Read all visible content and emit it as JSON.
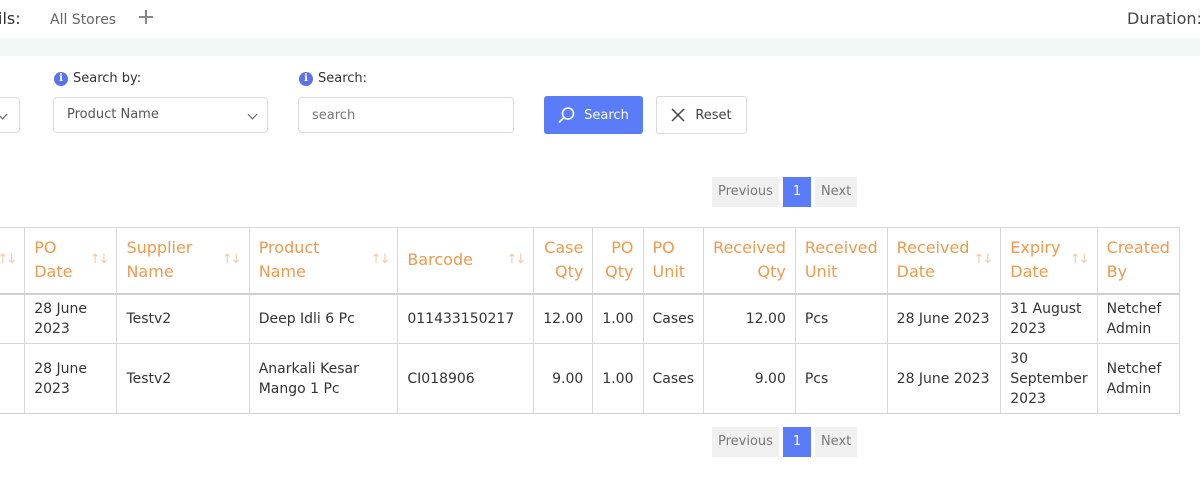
{
  "topbar": {
    "label": "ils:",
    "store": "All Stores",
    "duration_label": "Duration:"
  },
  "filters": {
    "search_by_label": "Search by:",
    "search_by_value": "Product Name",
    "search_label": "Search:",
    "search_placeholder": "search",
    "search_button": "Search",
    "reset_button": "Reset"
  },
  "pagination": {
    "previous": "Previous",
    "current": "1",
    "next": "Next"
  },
  "table": {
    "columns": [
      "PO Date",
      "Supplier Name",
      "Product Name",
      "Barcode",
      "Case Qty",
      "PO Qty",
      "PO Unit",
      "Received Qty",
      "Received Unit",
      "Received Date",
      "Expiry Date",
      "Created By"
    ],
    "rows": [
      [
        "28 June 2023",
        "Testv2",
        "Deep Idli 6 Pc",
        "011433150217",
        "12.00",
        "1.00",
        "Cases",
        "12.00",
        "Pcs",
        "28 June 2023",
        "31 August 2023",
        "Netchef Admin"
      ],
      [
        "28 June 2023",
        "Testv2",
        "Anarkali Kesar Mango 1 Pc",
        "CI018906",
        "9.00",
        "1.00",
        "Cases",
        "9.00",
        "Pcs",
        "28 June 2023",
        "30 September 2023",
        "Netchef Admin"
      ]
    ]
  },
  "colors": {
    "accent": "#5b7cf9",
    "header_text": "#ee9a4d",
    "strip": "#f1f8f6"
  }
}
